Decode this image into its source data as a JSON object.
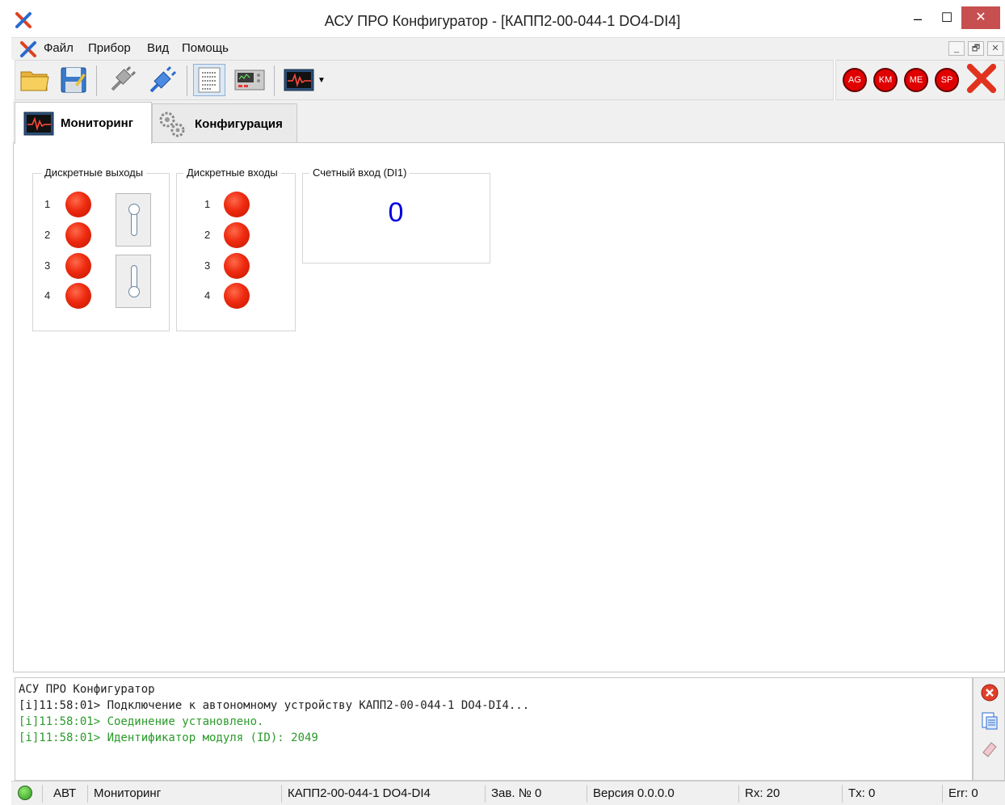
{
  "window": {
    "title": "АСУ ПРО Конфигуратор - [КАПП2-00-044-1 DO4-DI4]",
    "controls": {
      "minimize": "–",
      "maximize": "☐",
      "close": "✕"
    }
  },
  "menu": {
    "items": [
      "Файл",
      "Прибор",
      "Вид",
      "Помощь"
    ],
    "mdi_controls": [
      "_",
      "🗗",
      "✕"
    ]
  },
  "toolbar": {
    "buttons": [
      "open-folder-icon",
      "save-icon",
      "disconnect-plug-icon",
      "connect-plug-icon",
      "list-view-icon",
      "device-panel-icon",
      "monitor-chart-icon"
    ],
    "status_buttons": [
      "AG",
      "KM",
      "ME",
      "SP"
    ]
  },
  "tabs": [
    {
      "label": "Мониторинг",
      "active": true
    },
    {
      "label": "Конфигурация",
      "active": false
    }
  ],
  "monitoring": {
    "outputs": {
      "title": "Дискретные выходы",
      "rows": [
        "1",
        "2",
        "3",
        "4"
      ]
    },
    "inputs": {
      "title": "Дискретные входы",
      "rows": [
        "1",
        "2",
        "3",
        "4"
      ]
    },
    "counter": {
      "title": "Счетный вход (DI1)",
      "value": "0"
    }
  },
  "log": {
    "lines": [
      "АСУ ПРО Конфигуратор",
      "[i]11:58:01> Подключение к автономному устройству КАПП2-00-044-1 DO4-DI4...",
      "[i]11:58:01> Соединение установлено.",
      "[i]11:58:01> Идентификатор модуля (ID): 2049"
    ]
  },
  "statusbar": {
    "mode": "АВТ",
    "view": "Мониторинг",
    "device": "КАПП2-00-044-1 DO4-DI4",
    "serial": "Зав. № 0",
    "version": "Версия 0.0.0.0",
    "rx": "Rx: 20",
    "tx": "Tx: 0",
    "err": "Err: 0"
  },
  "colors": {
    "led_red": "#ee2a10",
    "led_green": "#2d9a1e",
    "counter_blue": "#0000e0",
    "log_green": "#2a9a2a",
    "close_button": "#c74f4f"
  }
}
